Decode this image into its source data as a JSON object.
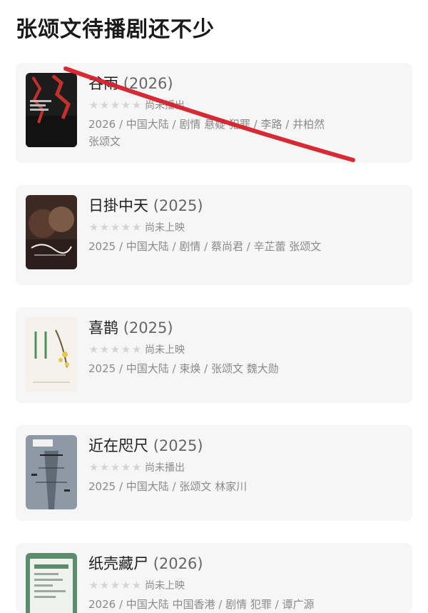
{
  "page": {
    "title": "张颂文待播剧还不少"
  },
  "items": [
    {
      "title": "谷雨",
      "year": "(2026)",
      "status": "尚未播出",
      "meta": "2026 / 中国大陆 / 剧情 悬疑 犯罪 / 李路 / 井柏然 张颂文",
      "poster": {
        "text": "谷雨",
        "subtext": "BATTLE ON PROMISE",
        "bg": "#1d1c1c",
        "accent": "#c4302b"
      }
    },
    {
      "title": "日掛中天",
      "year": "(2025)",
      "status": "尚未上映",
      "meta": "2025 / 中国大陆 / 剧情 / 蔡尚君 / 辛芷蕾 张颂文",
      "poster": {
        "text": "日掛中天",
        "bg": "#3a2a22",
        "accent": "#f2ece4"
      }
    },
    {
      "title": "喜鹊",
      "year": "(2025)",
      "status": "尚未上映",
      "meta": "2025 / 中国大陆 / 束焕 / 张颂文 魏大勋",
      "poster": {
        "text": "喜鹊",
        "bg": "#f4f2ea",
        "accent": "#4f8f5c"
      }
    },
    {
      "title": "近在咫尺",
      "year": "(2025)",
      "status": "尚未播出",
      "meta": "2025 / 中国大陆 / 张颂文 林家川",
      "poster": {
        "text": "近在咫尺",
        "bg": "#8d9aa6",
        "accent": "#222222"
      }
    },
    {
      "title": "纸壳藏尸",
      "year": "(2026)",
      "status": "尚未上映",
      "meta": "2026 / 中国大陆 中国香港 / 剧情 犯罪 / 谭广源",
      "poster": {
        "text": "",
        "bg": "#5b8c6c",
        "accent": "#eef3ee"
      }
    }
  ],
  "colors": {
    "card_bg": "#f6f6f6",
    "star_empty": "#d4d4d4",
    "strike_line": "#d41f2a"
  }
}
